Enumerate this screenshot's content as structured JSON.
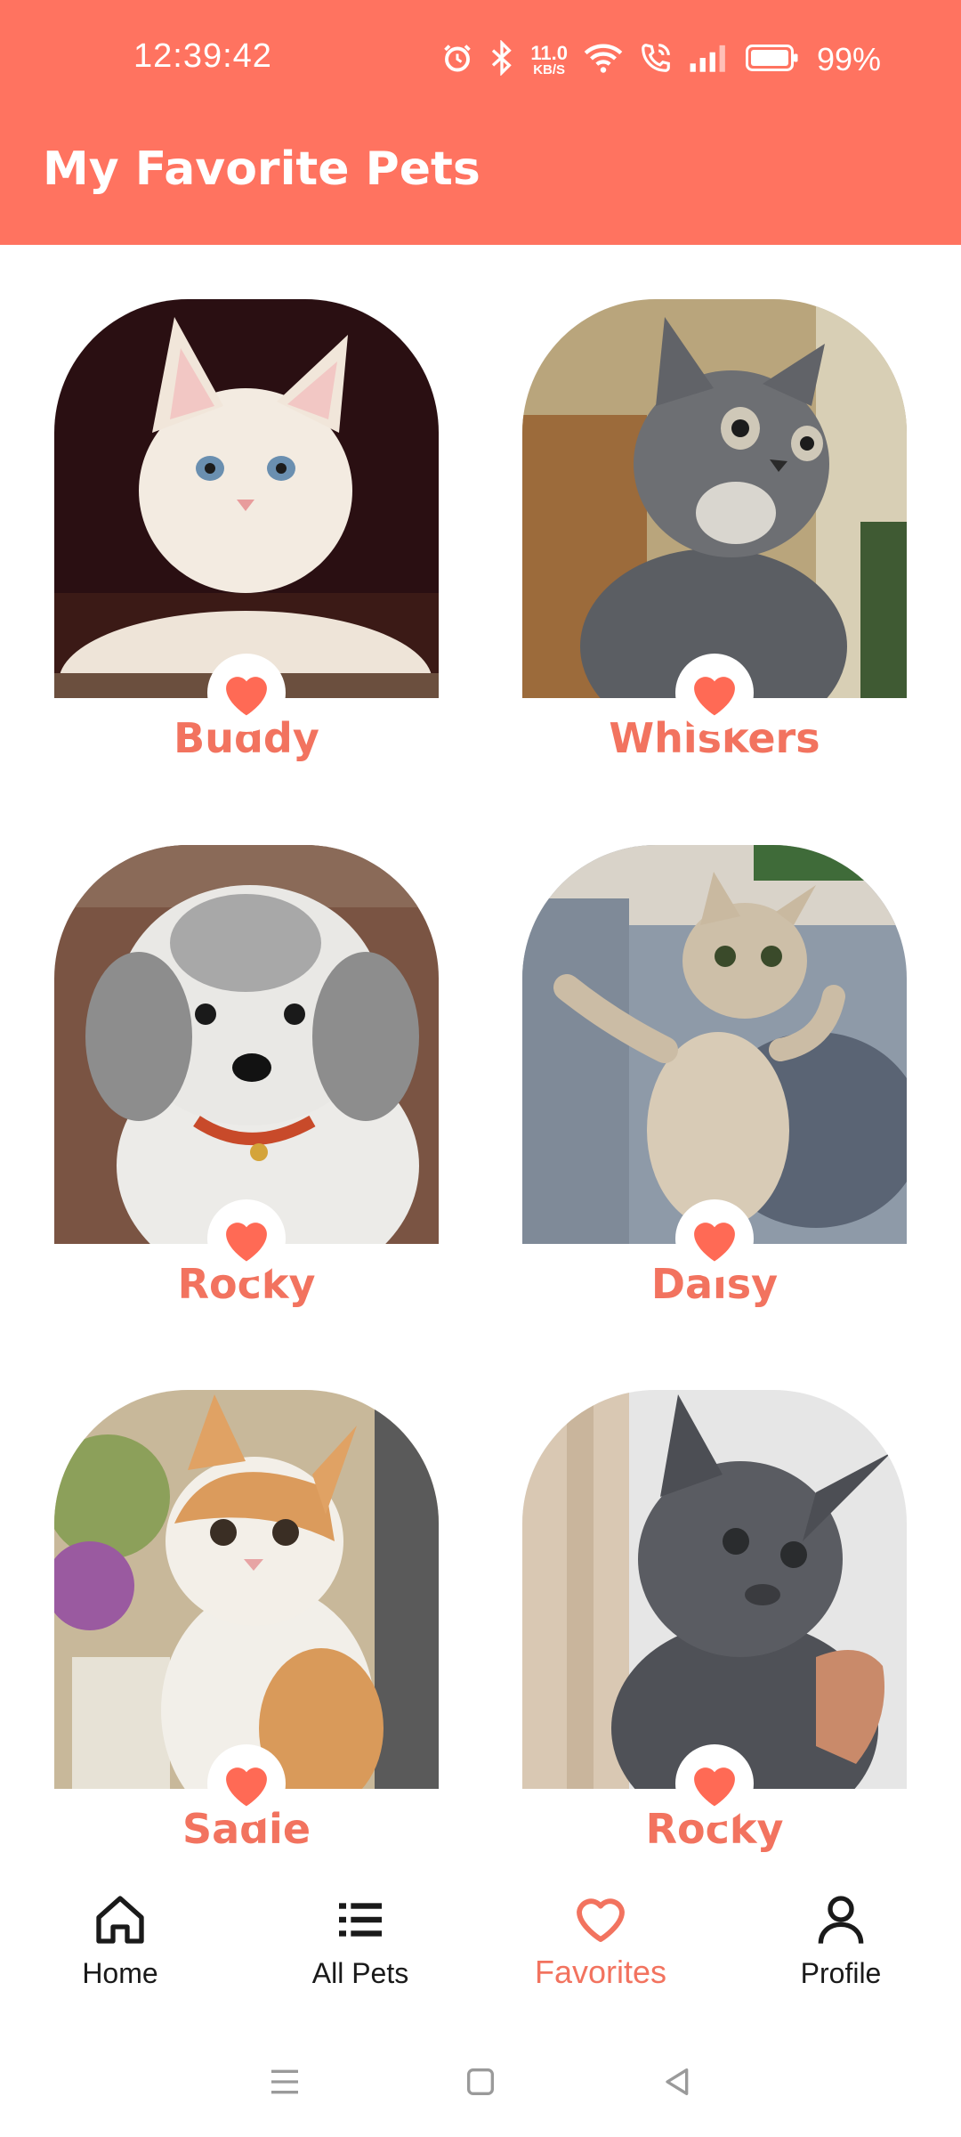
{
  "status_bar": {
    "time": "12:39:42",
    "net_speed_value": "11.0",
    "net_speed_unit": "KB/S",
    "battery": "99%",
    "icons": [
      "alarm-icon",
      "bluetooth-icon",
      "wifi-icon",
      "wifi-calling-icon",
      "signal-icon",
      "battery-icon"
    ]
  },
  "app_bar": {
    "title": "My Favorite Pets",
    "color": "#ff7360"
  },
  "pets": [
    {
      "name": "Buddy",
      "favorite": true
    },
    {
      "name": "Whiskers",
      "favorite": true
    },
    {
      "name": "Rocky",
      "favorite": true
    },
    {
      "name": "Daisy",
      "favorite": true
    },
    {
      "name": "Sadie",
      "favorite": true
    },
    {
      "name": "Rocky",
      "favorite": true
    }
  ],
  "bottom_nav": {
    "items": [
      {
        "label": "Home",
        "icon": "home-icon"
      },
      {
        "label": "All Pets",
        "icon": "list-icon"
      },
      {
        "label": "Favorites",
        "icon": "heart-outline-icon",
        "active": true
      },
      {
        "label": "Profile",
        "icon": "person-icon"
      }
    ]
  },
  "accent_color": "#f2735f"
}
